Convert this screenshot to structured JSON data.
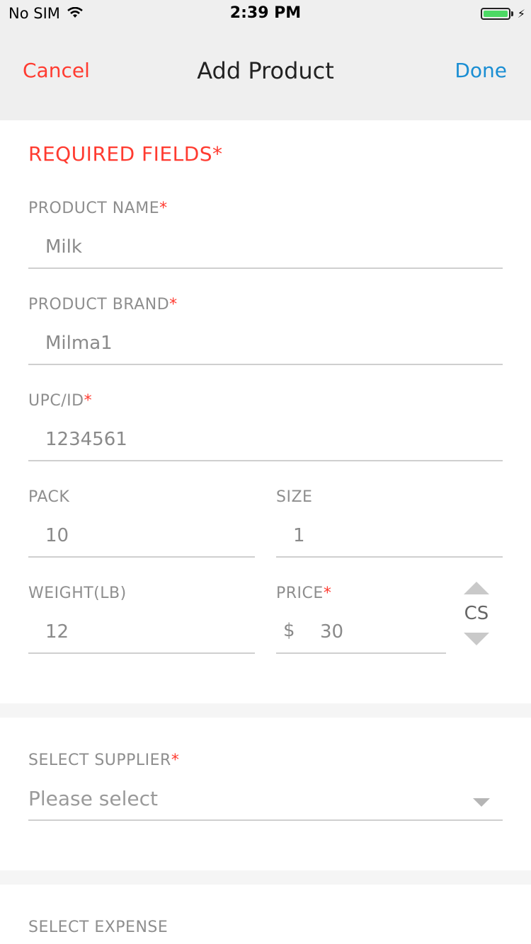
{
  "status_bar": {
    "carrier": "No SIM",
    "time": "2:39 PM",
    "battery_level": 1.0,
    "battery_color": "#4cd964",
    "charging_icon": "bolt-icon"
  },
  "nav": {
    "cancel_label": "Cancel",
    "title": "Add Product",
    "done_label": "Done",
    "cancel_color": "#ff3b30",
    "done_color": "#1a8ed3"
  },
  "required_section": {
    "title": "REQUIRED FIELDS",
    "star": "*"
  },
  "fields": {
    "product_name": {
      "label": "PRODUCT NAME",
      "star": "*",
      "value": "Milk"
    },
    "product_brand": {
      "label": "PRODUCT BRAND",
      "star": "*",
      "value": "Milma1"
    },
    "upc_id": {
      "label": "UPC/ID",
      "star": "*",
      "value": "1234561"
    },
    "pack": {
      "label": "PACK",
      "value": "10"
    },
    "size": {
      "label": "SIZE",
      "value": "1"
    },
    "weight": {
      "label": "WEIGHT(LB)",
      "value": "12"
    },
    "price": {
      "label": "PRICE",
      "star": "*",
      "currency": "$",
      "value": "30",
      "unit": "CS"
    }
  },
  "supplier": {
    "label": "SELECT SUPPLIER",
    "star": "*",
    "value": "Please select"
  },
  "expense": {
    "label": "SELECT EXPENSE"
  }
}
